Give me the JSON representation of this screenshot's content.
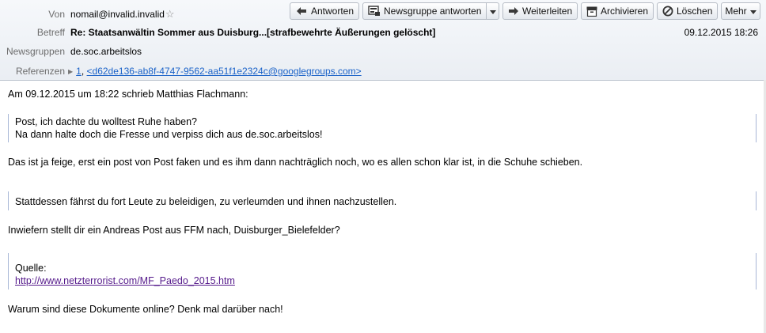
{
  "header": {
    "from_label": "Von",
    "from_value": "nomail@invalid.invalid",
    "subject_label": "Betreff",
    "subject_value": "Re: Staatsanwältin Sommer aus Duisburg...[strafbewehrte Äußerungen gelöscht]",
    "date": "09.12.2015 18:26",
    "newsgroups_label": "Newsgruppen",
    "newsgroups_value": "de.soc.arbeitslos",
    "references_label": "Referenzen",
    "references_count": "1",
    "references_sep": ",",
    "references_id": "<d62de136-ab8f-4747-9562-aa51f1e2324c@googlegroups.com>"
  },
  "toolbar": {
    "reply": "Antworten",
    "reply_group": "Newsgruppe antworten",
    "forward": "Weiterleiten",
    "archive": "Archivieren",
    "delete": "Löschen",
    "more": "Mehr"
  },
  "icons": {
    "reply": "reply-arrow-icon",
    "reply_group": "newsgroup-reply-icon",
    "forward": "forward-arrow-icon",
    "archive": "archive-box-icon",
    "delete": "delete-circle-icon",
    "star": "star-icon"
  },
  "colors": {
    "link": "#1a62c8",
    "visited_link": "#551a8b",
    "quote_bar": "#a7b6d6"
  },
  "body": {
    "intro": "Am 09.12.2015 um 18:22 schrieb Matthias Flachmann:",
    "quote1_line1": "Post, ich dachte du wolltest Ruhe haben?",
    "quote1_line2": "Na dann halte doch die Fresse und verpiss dich aus de.soc.arbeitslos!",
    "para1": "Das ist ja feige, erst ein post von Post faken und es ihm dann nachträglich noch, wo es allen schon klar ist, in die Schuhe schieben.",
    "quote2": "Stattdessen fährst du fort Leute zu beleidigen, zu verleumden und ihnen nachzustellen.",
    "para2": "Inwiefern stellt dir ein Andreas  Post aus FFM nach, Duisburger_Bielefelder?",
    "quote3_label": "Quelle:",
    "quote3_link": "http://www.netzterrorist.com/MF_Paedo_2015.htm",
    "para3": "Warum sind diese Dokumente online? Denk mal darüber nach!"
  }
}
